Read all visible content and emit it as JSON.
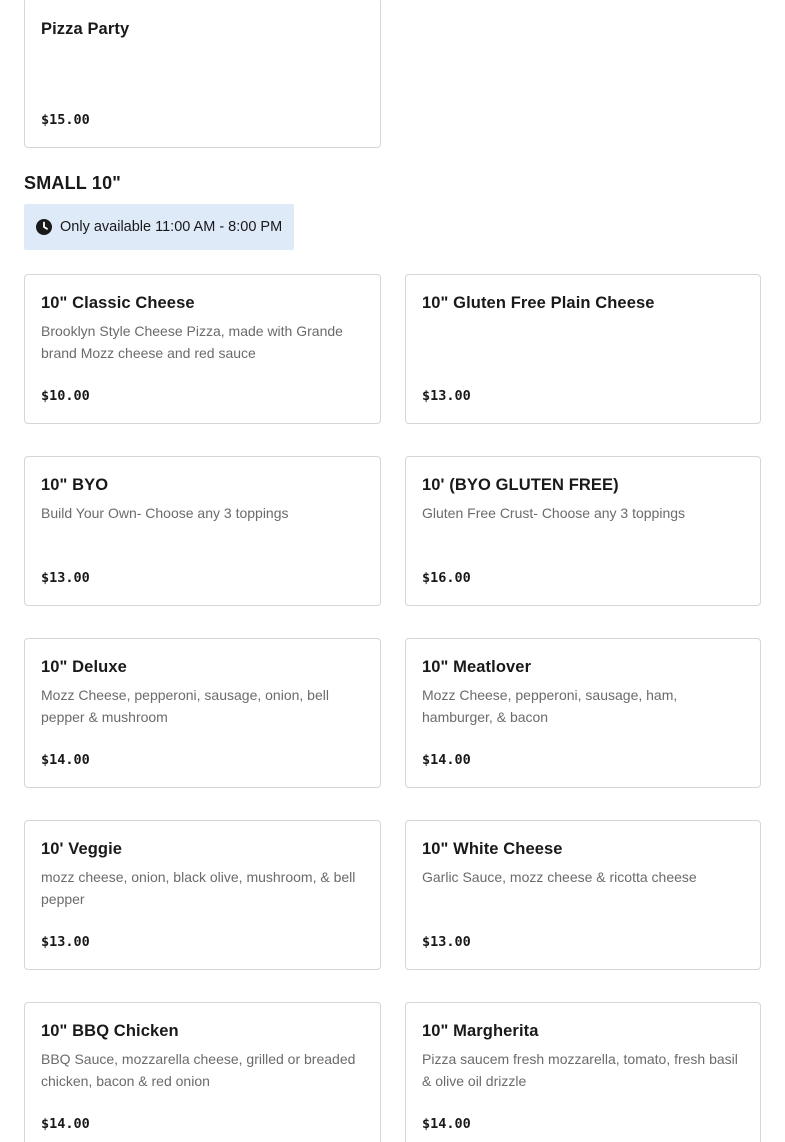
{
  "top_item": {
    "name": "Pizza Party",
    "description": "",
    "price": "$15.00"
  },
  "section": {
    "title": "SMALL 10\"",
    "availability": "Only available 11:00 AM - 8:00 PM",
    "icon": "clock-icon",
    "availability_bg": "#dfeaf9"
  },
  "items": [
    {
      "name": "10\" Classic Cheese",
      "description": "Brooklyn Style Cheese Pizza, made with Grande brand Mozz cheese and red sauce",
      "price": "$10.00"
    },
    {
      "name": "10\" Gluten Free Plain Cheese",
      "description": "",
      "price": "$13.00"
    },
    {
      "name": "10\" BYO",
      "description": "Build Your Own- Choose any 3 toppings",
      "price": "$13.00"
    },
    {
      "name": "10' (BYO GLUTEN FREE)",
      "description": "Gluten Free Crust- Choose any 3 toppings",
      "price": "$16.00"
    },
    {
      "name": "10\" Deluxe",
      "description": "Mozz Cheese, pepperoni, sausage, onion, bell pepper & mushroom",
      "price": "$14.00"
    },
    {
      "name": "10\" Meatlover",
      "description": "Mozz Cheese, pepperoni, sausage, ham, hamburger, & bacon",
      "price": "$14.00"
    },
    {
      "name": "10' Veggie",
      "description": "mozz cheese, onion, black olive, mushroom, & bell pepper",
      "price": "$13.00"
    },
    {
      "name": "10\" White Cheese",
      "description": "Garlic Sauce, mozz cheese & ricotta cheese",
      "price": "$13.00"
    },
    {
      "name": "10\" BBQ Chicken",
      "description": "BBQ Sauce, mozzarella cheese, grilled or breaded chicken, bacon & red onion",
      "price": "$14.00"
    },
    {
      "name": "10\" Margherita",
      "description": "Pizza saucem fresh mozzarella, tomato, fresh basil & olive oil drizzle",
      "price": "$14.00"
    }
  ]
}
